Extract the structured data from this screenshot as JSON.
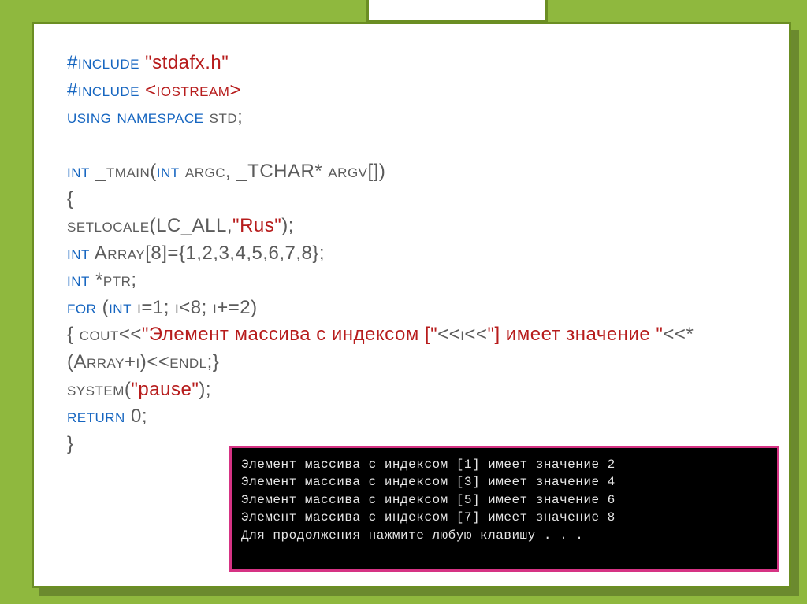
{
  "code": {
    "inc1a": "#include ",
    "inc1b": "\"stdafx.h\"",
    "inc2a": "#include ",
    "inc2b": "<iostream>",
    "ns1": "using namespace ",
    "ns2": "std;",
    "m1": "int ",
    "m2": "_tmain(",
    "m3": "int ",
    "m4": "argc, _TCHAR* argv[])",
    "ob": "{",
    "loc1": "setlocale(LC_ALL,",
    "loc2": "\"Rus\"",
    "loc3": ");",
    "arr1": "int ",
    "arr2": "Array[8]={1,2,3,4,5,6,7,8};",
    "ptr1": "int ",
    "ptr2": "*ptr;",
    "for1": "for ",
    "for2": "(",
    "for3": "int ",
    "for4": "i=1; i<8; i+=2)",
    "c1": "{ cout<<",
    "c2": "\"Элемент массива с индексом [\"",
    "c3": "<<i<<",
    "c4": "\"] имеет значение \"",
    "c5": "<<*(Array+i)<<endl;}",
    "sys1": "system(",
    "sys2": "\"pause\"",
    "sys3": ");",
    "ret1": "return ",
    "ret2": "0;",
    "cb": "}"
  },
  "console": {
    "l1": "Элемент массива с индексом [1] имеет значение 2",
    "l2": "Элемент массива с индексом [3] имеет значение 4",
    "l3": "Элемент массива с индексом [5] имеет значение 6",
    "l4": "Элемент массива с индексом [7] имеет значение 8",
    "l5": "Для продолжения нажмите любую клавишу . . ."
  }
}
